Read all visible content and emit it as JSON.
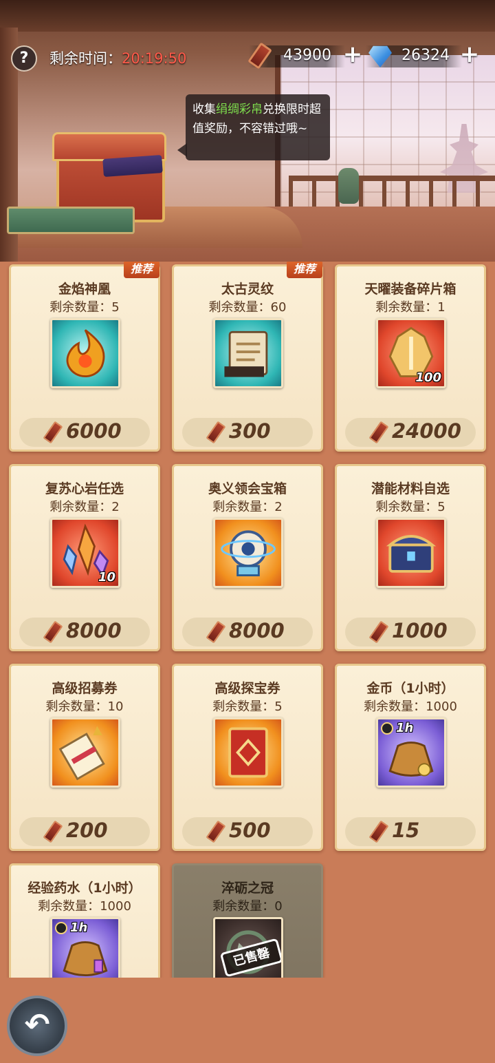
{
  "header": {
    "help_icon": "question-mark-icon",
    "timer_label": "剩余时间：",
    "timer_value": "20:19:50",
    "currency_silk": "43900",
    "currency_gem": "26324",
    "plus_label": "+",
    "tooltip_pre": "收集",
    "tooltip_highlight": "绢绸彩帛",
    "tooltip_post": "兑换限时超值奖励，不容错过哦~",
    "highlight_color": "#7fe04e"
  },
  "items": [
    {
      "name": "金焰神凰",
      "stock": "剩余数量：5",
      "price": "6000",
      "tag": "推荐",
      "icon": "phoenix-flame-icon"
    },
    {
      "name": "太古灵纹",
      "stock": "剩余数量：60",
      "price": "300",
      "tag": "推荐",
      "icon": "ancient-scroll-book-icon"
    },
    {
      "name": "天曜装备碎片箱",
      "stock": "剩余数量：1",
      "price": "24000",
      "qty": "100",
      "icon": "golden-armor-icon"
    },
    {
      "name": "复苏心岩任选",
      "stock": "剩余数量：2",
      "price": "8000",
      "qty": "10",
      "icon": "crystal-shards-icon"
    },
    {
      "name": "奥义领会宝箱",
      "stock": "剩余数量：2",
      "price": "8000",
      "icon": "orb-chest-icon"
    },
    {
      "name": "潜能材料自选",
      "stock": "剩余数量：5",
      "price": "1000",
      "icon": "treasure-chest-icon"
    },
    {
      "name": "高级招募券",
      "stock": "剩余数量：10",
      "price": "200",
      "icon": "scroll-icon"
    },
    {
      "name": "高级探宝券",
      "stock": "剩余数量：5",
      "price": "500",
      "icon": "treasure-card-icon"
    },
    {
      "name": "金币（1小时）",
      "stock": "剩余数量：1000",
      "price": "15",
      "hour": "1h",
      "icon": "gold-coin-bag-icon"
    },
    {
      "name": "经验药水（1小时）",
      "stock": "剩余数量：1000",
      "hour": "1h",
      "icon": "exp-potion-bag-icon"
    },
    {
      "name": "淬砺之冠",
      "stock": "剩余数量：0",
      "soldout": "已售罄",
      "icon": "crown-icon"
    }
  ],
  "back_icon": "back-arrow-icon",
  "back_glyph": "↶"
}
